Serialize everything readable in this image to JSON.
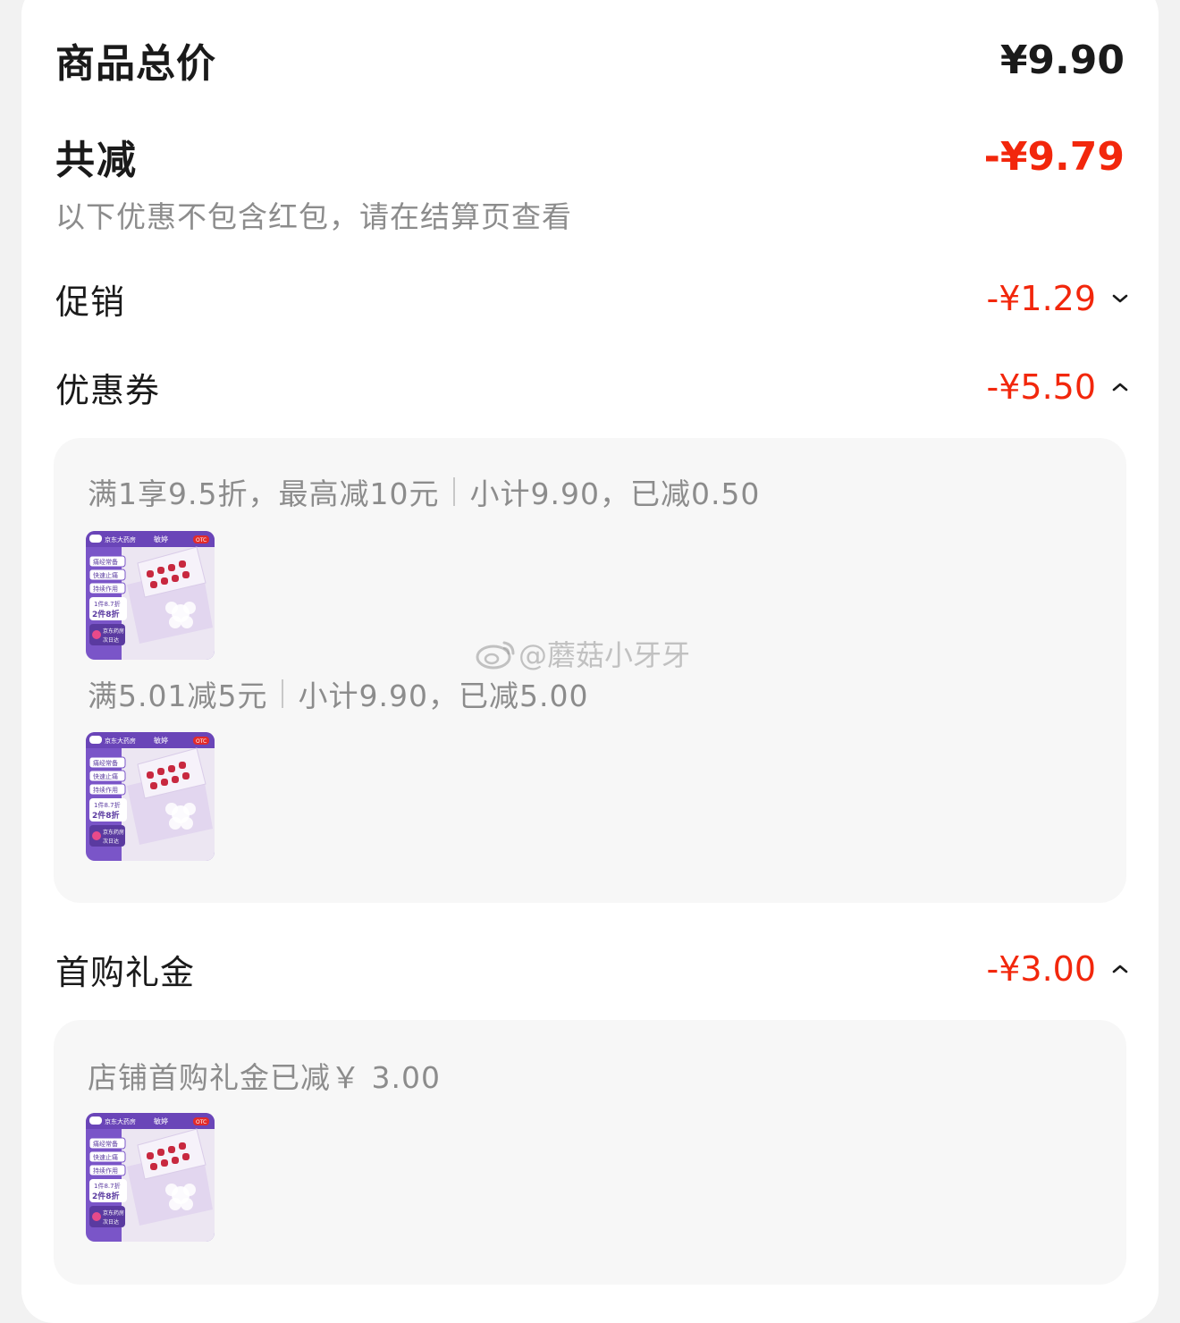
{
  "total": {
    "label": "商品总价",
    "value": "¥9.90"
  },
  "reduction": {
    "label": "共减",
    "value": "-¥9.79",
    "note": "以下优惠不包含红包，请在结算页查看"
  },
  "sections": {
    "promotion": {
      "label": "促销",
      "amount": "-¥1.29",
      "expanded": false
    },
    "coupon": {
      "label": "优惠券",
      "amount": "-¥5.50",
      "expanded": true,
      "items": [
        {
          "rule": "满1享9.5折，最高减10元",
          "detail": "小计9.90，已减0.50"
        },
        {
          "rule": "满5.01减5元",
          "detail": "小计9.90，已减5.00"
        }
      ]
    },
    "first_purchase": {
      "label": "首购礼金",
      "amount": "-¥3.00",
      "expanded": true,
      "items": [
        {
          "rule": "店铺首购礼金已减￥ 3.00"
        }
      ]
    }
  },
  "product_thumb": {
    "brand": "京东大药房",
    "product": "敏婷",
    "otc": "OTC",
    "tags": [
      "痛经常备",
      "快速止痛",
      "持续作用"
    ],
    "price_line1": "1件8.7折",
    "price_line2": "2件8折",
    "badge_line1": "京东药房",
    "badge_line2": "次日达"
  },
  "watermark": {
    "text": "@蘑菇小牙牙"
  },
  "colors": {
    "accent_red": "#f2270c",
    "muted_text": "#8c8c8c",
    "panel_bg": "#f7f7f7",
    "thumb_purple": "#7a55c8"
  }
}
